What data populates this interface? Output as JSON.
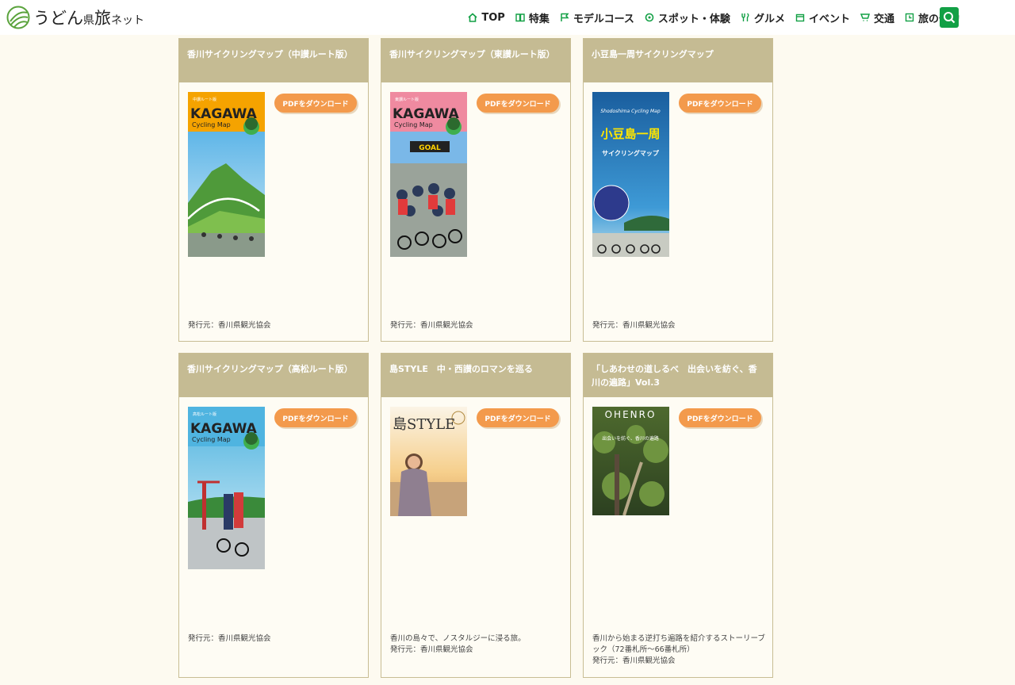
{
  "header": {
    "logo": {
      "part1": "うどん",
      "part2": "県",
      "part3": "旅",
      "part4": "ネット"
    },
    "nav": [
      {
        "label": "TOP",
        "icon": "home-icon"
      },
      {
        "label": "特集",
        "icon": "book-icon"
      },
      {
        "label": "モデルコース",
        "icon": "flag-icon"
      },
      {
        "label": "スポット・体験",
        "icon": "pin-icon"
      },
      {
        "label": "グルメ",
        "icon": "utensils-icon"
      },
      {
        "label": "イベント",
        "icon": "calendar-icon"
      },
      {
        "label": "交通",
        "icon": "transport-icon"
      },
      {
        "label": "旅の予約",
        "icon": "reserve-icon"
      }
    ],
    "search_icon": "search-icon",
    "accent_color": "#12a045"
  },
  "cards": [
    {
      "title": "香川サイクリングマップ（中讃ルート版）",
      "button": "PDFをダウンロード",
      "description": "",
      "publisher": "発行元：香川県観光協会",
      "cover": {
        "tag": "中讃ルート版",
        "brand": "KAGAWA",
        "sub": "Cycling Map",
        "color": "#f5a300"
      }
    },
    {
      "title": "香川サイクリングマップ（東讃ルート版）",
      "button": "PDFをダウンロード",
      "description": "",
      "publisher": "発行元：香川県観光協会",
      "cover": {
        "tag": "東讃ルート版",
        "brand": "KAGAWA",
        "sub": "Cycling Map",
        "banner": "GOAL",
        "color": "#ef8aa0"
      }
    },
    {
      "title": "小豆島一周サイクリングマップ",
      "button": "PDFをダウンロード",
      "description": "",
      "publisher": "発行元：香川県観光協会",
      "cover": {
        "brand": "Shodoshima Cycling Map",
        "line1": "小豆島一周",
        "line2": "サイクリングマップ",
        "color": "#1f6fae"
      }
    },
    {
      "title": "香川サイクリングマップ（高松ルート版）",
      "button": "PDFをダウンロード",
      "description": "",
      "publisher": "発行元：香川県観光協会",
      "cover": {
        "tag": "高松ルート版",
        "brand": "KAGAWA",
        "sub": "Cycling Map",
        "color": "#4fb4e0"
      }
    },
    {
      "title": "島STYLE　中・西讃のロマンを巡る",
      "button": "PDFをダウンロード",
      "description": "香川の島々で、ノスタルジーに浸る旅。",
      "publisher": "発行元：香川県観光協会",
      "cover": {
        "brand": "島STYLE"
      }
    },
    {
      "title": "「しあわせの道しるべ　出会いを紡ぐ、香川の遍路」Vol.3",
      "button": "PDFをダウンロード",
      "description": "香川から始まる逆打ち遍路を紹介するストーリーブック（72番札所〜66番札所）",
      "publisher": "発行元：香川県観光協会",
      "cover": {
        "brand": "OHENRO",
        "sub": "出会いを紡ぐ、香川の遍路"
      }
    }
  ],
  "colors": {
    "page_bg": "#fdfaf0",
    "card_header": "#c5bb93",
    "button": "#f39a4c"
  }
}
